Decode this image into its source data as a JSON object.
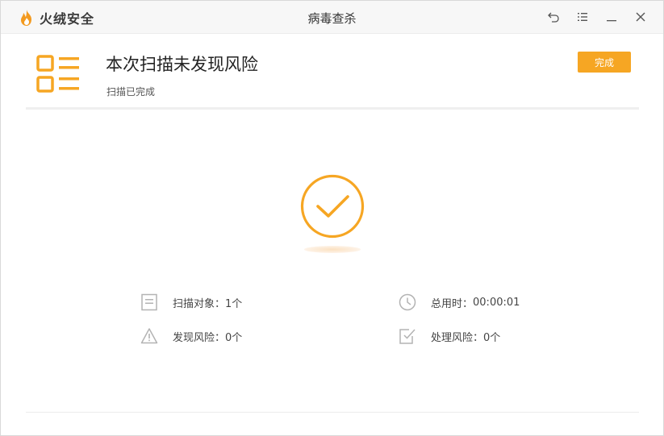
{
  "titlebar": {
    "brand": "火绒安全",
    "title": "病毒查杀",
    "controls": [
      "back-icon",
      "menu-icon",
      "minimize-icon",
      "close-icon"
    ]
  },
  "result": {
    "title": "本次扫描未发现风险",
    "subtitle": "扫描已完成",
    "button": "完成"
  },
  "stats": {
    "objects": {
      "label": "扫描对象：",
      "value": "1个",
      "icon": "document-icon"
    },
    "time": {
      "label": "总用时：",
      "value": "00:00:01",
      "icon": "clock-icon"
    },
    "found": {
      "label": "发现风险：",
      "value": "0个",
      "icon": "warning-icon"
    },
    "handled": {
      "label": "处理风险：",
      "value": "0个",
      "icon": "checkbox-icon"
    }
  },
  "colors": {
    "accent": "#f6a623",
    "icon_gray": "#b3b3b3"
  }
}
